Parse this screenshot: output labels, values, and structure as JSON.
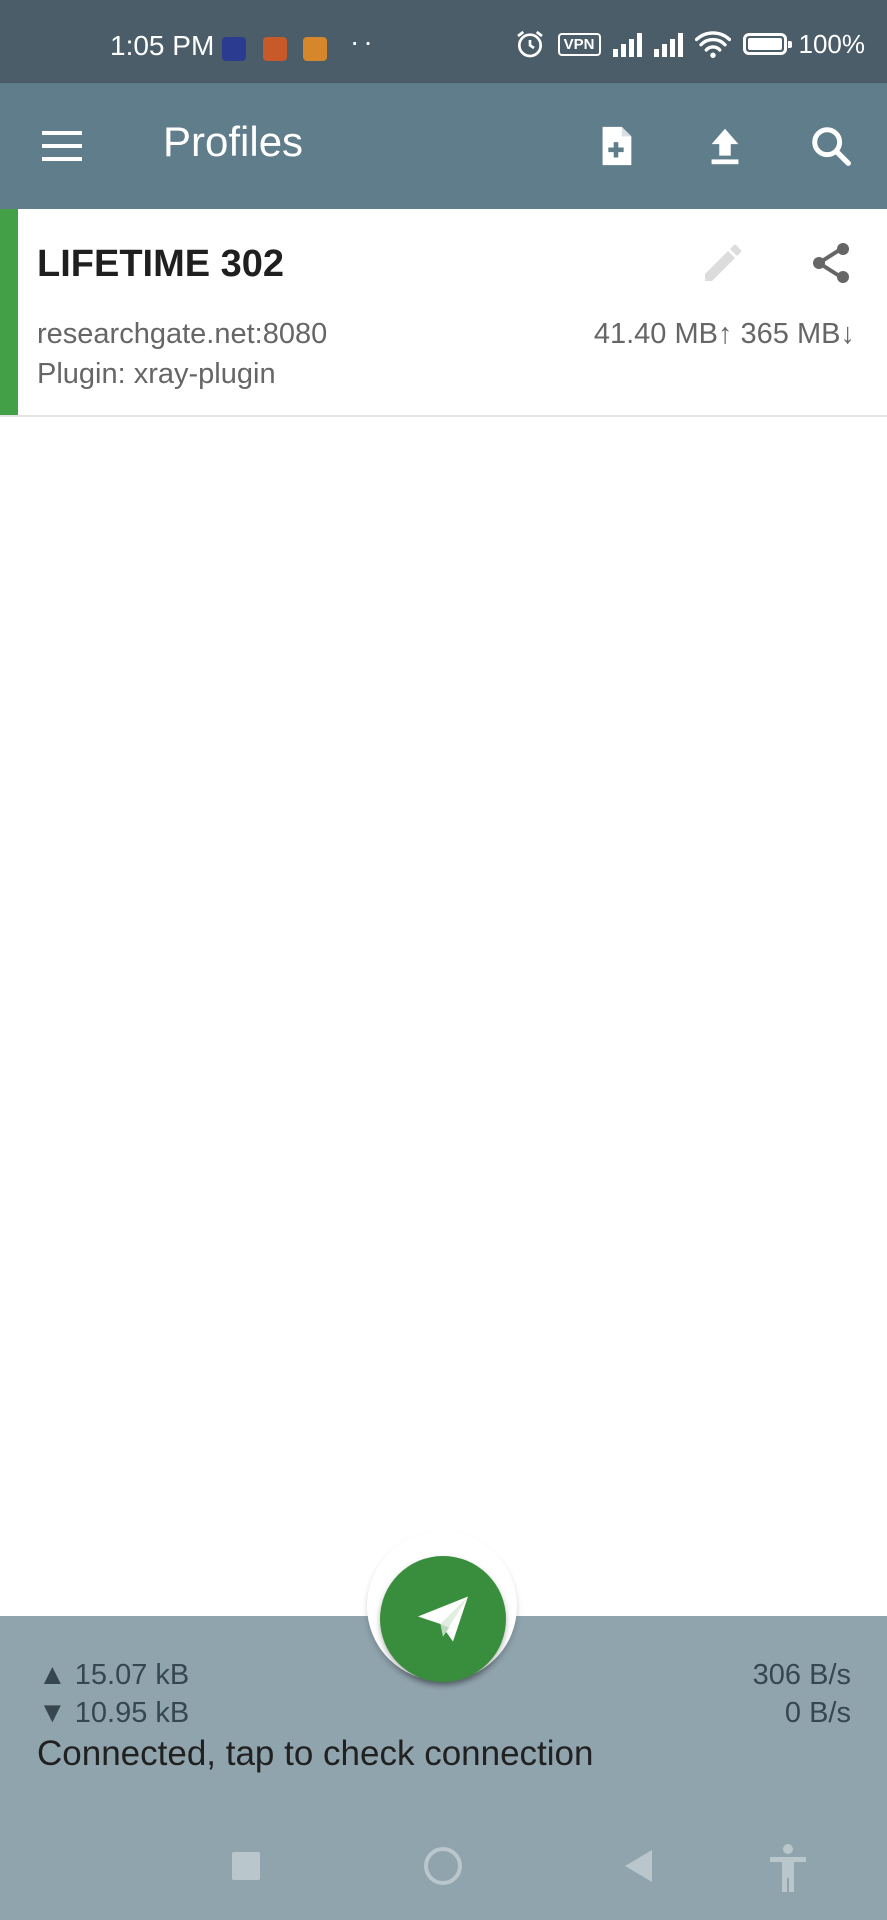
{
  "status_bar": {
    "time": "1:05 PM",
    "dots": "··",
    "vpn": "VPN",
    "battery": "100%"
  },
  "toolbar": {
    "title": "Profiles",
    "icons": [
      "menu-icon",
      "new-file-icon",
      "upload-icon",
      "search-icon"
    ]
  },
  "profiles": [
    {
      "name": "LIFETIME 302",
      "host": "researchgate.net:8080",
      "plugin": "Plugin: xray-plugin",
      "traffic": "41.40 MB↑ 365 MB↓",
      "selected": true
    }
  ],
  "stats": {
    "tx_total": "▲ 15.07 kB",
    "rx_total": "▼ 10.95 kB",
    "tx_rate": "306 B/s",
    "rx_rate": "0 B/s",
    "status": "Connected, tap to check connection"
  },
  "colors": {
    "status_bar": "#4b5d69",
    "toolbar": "#607d8b",
    "bottom_bar": "#90a4ae",
    "fab": "#388e3c",
    "indicator": "#43a047"
  }
}
